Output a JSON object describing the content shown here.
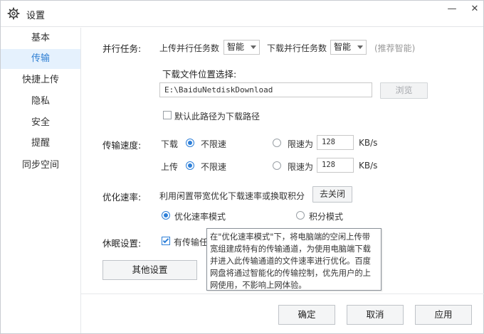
{
  "window": {
    "title": "设置",
    "minimize": "—",
    "close": "✕"
  },
  "sidebar": {
    "items": [
      {
        "label": "基本"
      },
      {
        "label": "传输"
      },
      {
        "label": "快捷上传"
      },
      {
        "label": "隐私"
      },
      {
        "label": "安全"
      },
      {
        "label": "提醒"
      },
      {
        "label": "同步空间"
      }
    ],
    "active_index": 1
  },
  "parallel": {
    "section_label": "并行任务:",
    "upload_label": "上传并行任务数",
    "upload_value": "智能",
    "download_label": "下载并行任务数",
    "download_value": "智能",
    "hint": "(推荐智能)"
  },
  "download_location": {
    "label": "下载文件位置选择:",
    "path": "E:\\BaiduNetdiskDownload",
    "browse": "浏览",
    "default_checkbox": "默认此路径为下载路径",
    "default_checked": false
  },
  "speed": {
    "section_label": "传输速度:",
    "download_label": "下载",
    "upload_label": "上传",
    "unlimited": "不限速",
    "limit": "限速为",
    "download_limit_value": "128",
    "upload_limit_value": "128",
    "unit": "KB/s",
    "download_unlimited_selected": true,
    "upload_unlimited_selected": true
  },
  "optimize": {
    "section_label": "优化速率:",
    "description": "利用闲置带宽优化下载速率或换取积分",
    "close_button": "去关闭",
    "mode_speed": "优化速率模式",
    "mode_points": "积分模式",
    "speed_selected": true
  },
  "sleep": {
    "section_label": "休眠设置:",
    "checkbox_label": "有传输任",
    "checked": true
  },
  "tooltip": {
    "text": "在\"优化速率模式\"下，将电脑端的空闲上传带宽组建成特有的传输通道，为使用电脑端下载并进入此传输通道的文件速率进行优化。百度网盘将通过智能化的传输控制，优先用户的上网使用，不影响上网体验。"
  },
  "other_settings": "其他设置",
  "footer": {
    "ok": "确定",
    "cancel": "取消",
    "apply": "应用"
  },
  "colors": {
    "accent": "#2d7fd8",
    "sidebar_active_bg": "#e5f1fd"
  }
}
